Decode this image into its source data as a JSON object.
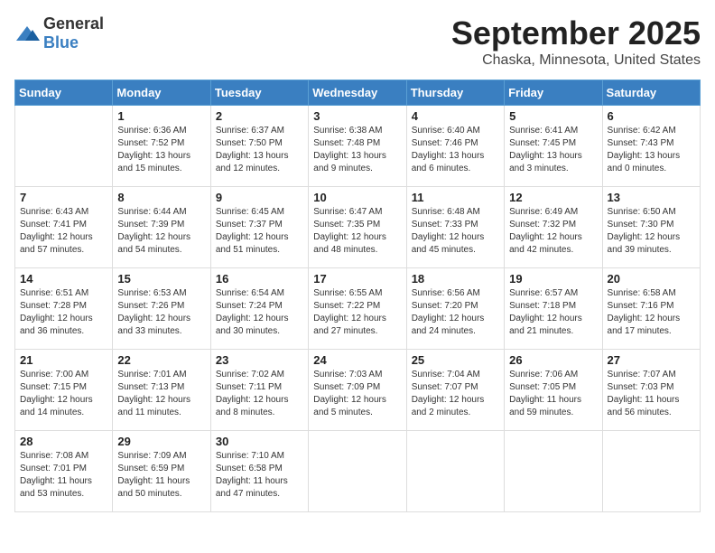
{
  "logo": {
    "general": "General",
    "blue": "Blue"
  },
  "header": {
    "month": "September 2025",
    "location": "Chaska, Minnesota, United States"
  },
  "weekdays": [
    "Sunday",
    "Monday",
    "Tuesday",
    "Wednesday",
    "Thursday",
    "Friday",
    "Saturday"
  ],
  "weeks": [
    [
      {
        "day": "",
        "sunrise": "",
        "sunset": "",
        "daylight": ""
      },
      {
        "day": "1",
        "sunrise": "Sunrise: 6:36 AM",
        "sunset": "Sunset: 7:52 PM",
        "daylight": "Daylight: 13 hours and 15 minutes."
      },
      {
        "day": "2",
        "sunrise": "Sunrise: 6:37 AM",
        "sunset": "Sunset: 7:50 PM",
        "daylight": "Daylight: 13 hours and 12 minutes."
      },
      {
        "day": "3",
        "sunrise": "Sunrise: 6:38 AM",
        "sunset": "Sunset: 7:48 PM",
        "daylight": "Daylight: 13 hours and 9 minutes."
      },
      {
        "day": "4",
        "sunrise": "Sunrise: 6:40 AM",
        "sunset": "Sunset: 7:46 PM",
        "daylight": "Daylight: 13 hours and 6 minutes."
      },
      {
        "day": "5",
        "sunrise": "Sunrise: 6:41 AM",
        "sunset": "Sunset: 7:45 PM",
        "daylight": "Daylight: 13 hours and 3 minutes."
      },
      {
        "day": "6",
        "sunrise": "Sunrise: 6:42 AM",
        "sunset": "Sunset: 7:43 PM",
        "daylight": "Daylight: 13 hours and 0 minutes."
      }
    ],
    [
      {
        "day": "7",
        "sunrise": "Sunrise: 6:43 AM",
        "sunset": "Sunset: 7:41 PM",
        "daylight": "Daylight: 12 hours and 57 minutes."
      },
      {
        "day": "8",
        "sunrise": "Sunrise: 6:44 AM",
        "sunset": "Sunset: 7:39 PM",
        "daylight": "Daylight: 12 hours and 54 minutes."
      },
      {
        "day": "9",
        "sunrise": "Sunrise: 6:45 AM",
        "sunset": "Sunset: 7:37 PM",
        "daylight": "Daylight: 12 hours and 51 minutes."
      },
      {
        "day": "10",
        "sunrise": "Sunrise: 6:47 AM",
        "sunset": "Sunset: 7:35 PM",
        "daylight": "Daylight: 12 hours and 48 minutes."
      },
      {
        "day": "11",
        "sunrise": "Sunrise: 6:48 AM",
        "sunset": "Sunset: 7:33 PM",
        "daylight": "Daylight: 12 hours and 45 minutes."
      },
      {
        "day": "12",
        "sunrise": "Sunrise: 6:49 AM",
        "sunset": "Sunset: 7:32 PM",
        "daylight": "Daylight: 12 hours and 42 minutes."
      },
      {
        "day": "13",
        "sunrise": "Sunrise: 6:50 AM",
        "sunset": "Sunset: 7:30 PM",
        "daylight": "Daylight: 12 hours and 39 minutes."
      }
    ],
    [
      {
        "day": "14",
        "sunrise": "Sunrise: 6:51 AM",
        "sunset": "Sunset: 7:28 PM",
        "daylight": "Daylight: 12 hours and 36 minutes."
      },
      {
        "day": "15",
        "sunrise": "Sunrise: 6:53 AM",
        "sunset": "Sunset: 7:26 PM",
        "daylight": "Daylight: 12 hours and 33 minutes."
      },
      {
        "day": "16",
        "sunrise": "Sunrise: 6:54 AM",
        "sunset": "Sunset: 7:24 PM",
        "daylight": "Daylight: 12 hours and 30 minutes."
      },
      {
        "day": "17",
        "sunrise": "Sunrise: 6:55 AM",
        "sunset": "Sunset: 7:22 PM",
        "daylight": "Daylight: 12 hours and 27 minutes."
      },
      {
        "day": "18",
        "sunrise": "Sunrise: 6:56 AM",
        "sunset": "Sunset: 7:20 PM",
        "daylight": "Daylight: 12 hours and 24 minutes."
      },
      {
        "day": "19",
        "sunrise": "Sunrise: 6:57 AM",
        "sunset": "Sunset: 7:18 PM",
        "daylight": "Daylight: 12 hours and 21 minutes."
      },
      {
        "day": "20",
        "sunrise": "Sunrise: 6:58 AM",
        "sunset": "Sunset: 7:16 PM",
        "daylight": "Daylight: 12 hours and 17 minutes."
      }
    ],
    [
      {
        "day": "21",
        "sunrise": "Sunrise: 7:00 AM",
        "sunset": "Sunset: 7:15 PM",
        "daylight": "Daylight: 12 hours and 14 minutes."
      },
      {
        "day": "22",
        "sunrise": "Sunrise: 7:01 AM",
        "sunset": "Sunset: 7:13 PM",
        "daylight": "Daylight: 12 hours and 11 minutes."
      },
      {
        "day": "23",
        "sunrise": "Sunrise: 7:02 AM",
        "sunset": "Sunset: 7:11 PM",
        "daylight": "Daylight: 12 hours and 8 minutes."
      },
      {
        "day": "24",
        "sunrise": "Sunrise: 7:03 AM",
        "sunset": "Sunset: 7:09 PM",
        "daylight": "Daylight: 12 hours and 5 minutes."
      },
      {
        "day": "25",
        "sunrise": "Sunrise: 7:04 AM",
        "sunset": "Sunset: 7:07 PM",
        "daylight": "Daylight: 12 hours and 2 minutes."
      },
      {
        "day": "26",
        "sunrise": "Sunrise: 7:06 AM",
        "sunset": "Sunset: 7:05 PM",
        "daylight": "Daylight: 11 hours and 59 minutes."
      },
      {
        "day": "27",
        "sunrise": "Sunrise: 7:07 AM",
        "sunset": "Sunset: 7:03 PM",
        "daylight": "Daylight: 11 hours and 56 minutes."
      }
    ],
    [
      {
        "day": "28",
        "sunrise": "Sunrise: 7:08 AM",
        "sunset": "Sunset: 7:01 PM",
        "daylight": "Daylight: 11 hours and 53 minutes."
      },
      {
        "day": "29",
        "sunrise": "Sunrise: 7:09 AM",
        "sunset": "Sunset: 6:59 PM",
        "daylight": "Daylight: 11 hours and 50 minutes."
      },
      {
        "day": "30",
        "sunrise": "Sunrise: 7:10 AM",
        "sunset": "Sunset: 6:58 PM",
        "daylight": "Daylight: 11 hours and 47 minutes."
      },
      {
        "day": "",
        "sunrise": "",
        "sunset": "",
        "daylight": ""
      },
      {
        "day": "",
        "sunrise": "",
        "sunset": "",
        "daylight": ""
      },
      {
        "day": "",
        "sunrise": "",
        "sunset": "",
        "daylight": ""
      },
      {
        "day": "",
        "sunrise": "",
        "sunset": "",
        "daylight": ""
      }
    ]
  ]
}
